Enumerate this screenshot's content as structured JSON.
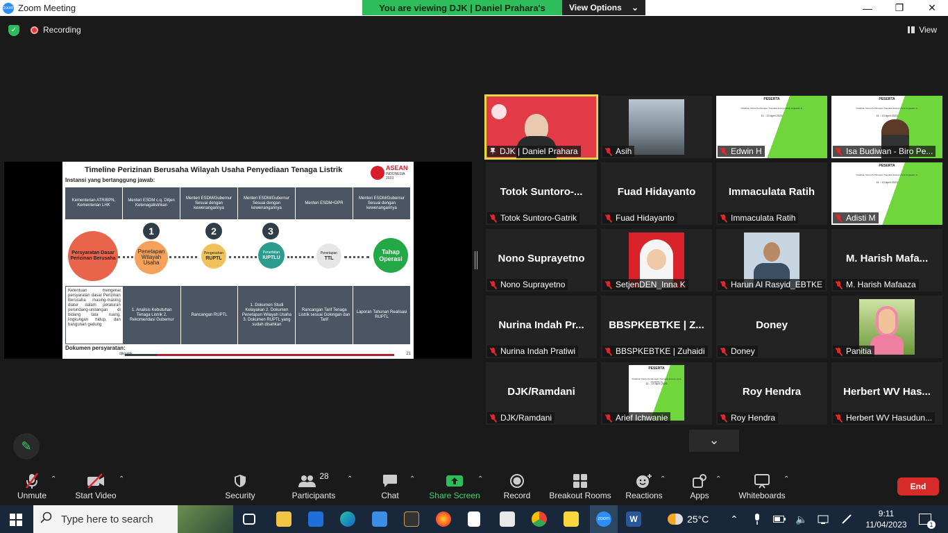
{
  "window": {
    "title": "Zoom Meeting",
    "minimize": "—",
    "restore": "❐",
    "close": "✕"
  },
  "banner": {
    "viewing_text": "You are viewing DJK | Daniel Prahara's screen",
    "view_options": "View Options",
    "view_options_icon": "⌄"
  },
  "status": {
    "recording": "Recording",
    "view": "View"
  },
  "slide": {
    "title": "Timeline Perizinan Berusaha Wilayah Usaha Penyediaan Tenaga Listrik",
    "logo_text": "ASEAN",
    "logo_sub": "INDONESIA 2023",
    "instansi": "Instansi yang bertanggung jawab:",
    "header_cells": [
      "Kementerian ATR/BPN, Kementerian LHK",
      "Menteri ESDM c.q. Ditjen Ketenagalistrikan",
      "Menteri ESDM/Gubernur Sesuai dengan kewenangannya",
      "Menteri ESDM/Gubernur Sesuai dengan kewenangannya",
      "Menteri ESDM+DPR",
      "Menteri ESDM/Gubernur Sesuai dengan kewenangannya"
    ],
    "steps": {
      "start": "Persyaratan Dasar Perizinan Berusaha",
      "s1": "Penetapan Wilayah Usaha",
      "s2_pre": "Pengesahan",
      "s2": "RUPTL",
      "s3_pre": "Penerbitan",
      "s3": "IUPTLU",
      "s4_pre": "Penetapan",
      "s4": "TTL",
      "end": "Tahap Operasi",
      "n1": "1",
      "n2": "2",
      "n3": "3"
    },
    "bottom_cells": [
      "Ketentuan mengenai persyaratan dasar Perizinan Berusaha masing-masing diatur dalam peraturan perundang-undangan di bidang tata ruang, lingkungan hidup, dan bangunan gedung",
      "1. Analisis Kebutuhan Tenaga Listrik 2. Rekomendasi Gubernur",
      "Rancangan RUPTL",
      "1. Dokumen Studi Kelayakan 2. Dokumen Penetapan Wilayah Usaha 3. Dokumen RUPTL yang sudah disahkan",
      "Rancangan Tarif Tenaga Listrik sesuai Golongan dan Tarif",
      "Laporan Tahunan Realisasi RUPTL"
    ],
    "dokumen": "Dokumen persyaratan:",
    "footer_brand": "djkgatrik",
    "page_number": "21"
  },
  "gallery": [
    {
      "name": "DJK | Daniel Prahara",
      "big": "",
      "pinned": true
    },
    {
      "name": "Asih",
      "big": ""
    },
    {
      "name": "Edwin H",
      "big": ""
    },
    {
      "name": "Isa Budiwan - Biro Pe...",
      "big": ""
    },
    {
      "name": "Totok Suntoro-Gatrik",
      "big": "Totok  Suntoro-..."
    },
    {
      "name": "Fuad Hidayanto",
      "big": "Fuad Hidayanto"
    },
    {
      "name": "Immaculata Ratih",
      "big": "Immaculata Ratih"
    },
    {
      "name": "Adisti M",
      "big": ""
    },
    {
      "name": "Nono Suprayetno",
      "big": "Nono Suprayetno"
    },
    {
      "name": "SetjenDEN_Inna K",
      "big": ""
    },
    {
      "name": "Harun Al Rasyid_EBTKE",
      "big": ""
    },
    {
      "name": "M. Harish Mafaaza",
      "big": "M.  Harish  Mafa..."
    },
    {
      "name": "Nurina Indah Pratiwi",
      "big": "Nurina  Indah  Pr..."
    },
    {
      "name": "BBSPKEBTKE | Zuhaidi",
      "big": "BBSPKEBTKE  |  Z..."
    },
    {
      "name": "Doney",
      "big": "Doney"
    },
    {
      "name": "Panitia",
      "big": ""
    },
    {
      "name": "DJK/Ramdani",
      "big": "DJK/Ramdani"
    },
    {
      "name": "Arief Ichwanie",
      "big": ""
    },
    {
      "name": "Roy Hendra",
      "big": "Roy Hendra"
    },
    {
      "name": "Herbert WV Hasudun...",
      "big": "Herbert  WV  Has..."
    }
  ],
  "thumb_slide": {
    "heading": "PESERTA",
    "line": "Pelatihan Teknis Perhitungan Transaksi Energi Listrik (Angkatan 3)",
    "dates": "11 - 13 April 2023"
  },
  "toolbar": {
    "unmute": "Unmute",
    "start_video": "Start Video",
    "security": "Security",
    "participants": "Participants",
    "participants_count": "28",
    "chat": "Chat",
    "share_screen": "Share Screen",
    "record": "Record",
    "breakout_rooms": "Breakout Rooms",
    "reactions": "Reactions",
    "apps": "Apps",
    "whiteboards": "Whiteboards",
    "end": "End"
  },
  "taskbar": {
    "search_placeholder": "Type here to search",
    "weather": "25°C",
    "time": "9:11",
    "date": "11/04/2023",
    "notifications": "1"
  },
  "colors": {
    "banner_green": "#2dbd5b",
    "end_red": "#d92a2a",
    "active_outline": "#e6d84a",
    "muted_red": "#e0262f"
  }
}
